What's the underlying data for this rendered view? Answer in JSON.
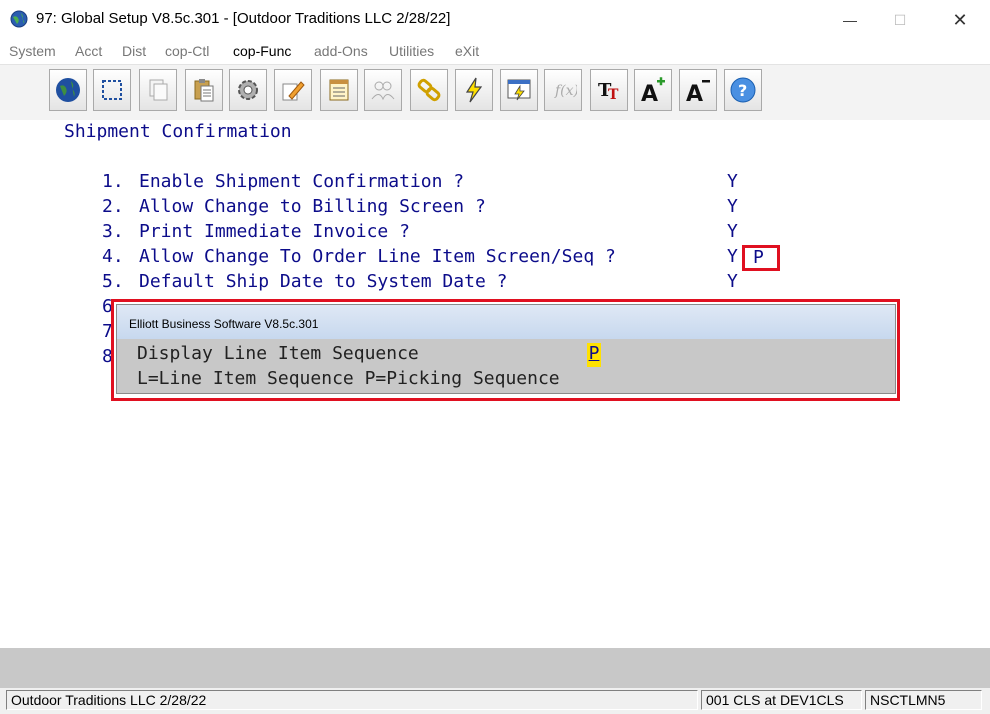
{
  "window": {
    "title": "97: Global Setup V8.5c.301 - [Outdoor Traditions LLC 2/28/22]",
    "minimize_glyph": "—",
    "maximize_glyph": "☐",
    "close_glyph": "✕"
  },
  "menu": [
    {
      "label": "System",
      "active": false
    },
    {
      "label": "Acct",
      "active": false
    },
    {
      "label": "Dist",
      "active": false
    },
    {
      "label": "cop-Ctl",
      "active": false
    },
    {
      "label": "cop-Func",
      "active": true
    },
    {
      "label": "add-Ons",
      "active": false
    },
    {
      "label": "Utilities",
      "active": false
    },
    {
      "label": "eXit",
      "active": false
    }
  ],
  "toolbar": [
    {
      "icon": "globe-icon",
      "enabled": true
    },
    {
      "icon": "select-icon",
      "enabled": true
    },
    {
      "icon": "copy-icon",
      "enabled": false
    },
    {
      "icon": "paste-icon",
      "enabled": true
    },
    {
      "icon": "settings-icon",
      "enabled": true
    },
    {
      "icon": "edit-icon",
      "enabled": true
    },
    {
      "icon": "notes-icon",
      "enabled": true
    },
    {
      "icon": "users-icon",
      "enabled": false
    },
    {
      "icon": "link-icon",
      "enabled": true
    },
    {
      "icon": "lightning-icon",
      "enabled": true
    },
    {
      "icon": "quick-screen-icon",
      "enabled": true
    },
    {
      "icon": "function-icon",
      "enabled": false
    },
    {
      "icon": "font-icon",
      "enabled": true
    },
    {
      "icon": "font-increase-icon",
      "enabled": true
    },
    {
      "icon": "font-decrease-icon",
      "enabled": true
    },
    {
      "icon": "help-icon",
      "enabled": true
    }
  ],
  "screen": {
    "heading": "Shipment Confirmation",
    "items": [
      {
        "num": "1.",
        "label": "Enable Shipment Confirmation ?",
        "value": "Y"
      },
      {
        "num": "2.",
        "label": "Allow Change to Billing Screen ?",
        "value": "Y"
      },
      {
        "num": "3.",
        "label": "Print Immediate Invoice ?",
        "value": "Y"
      },
      {
        "num": "4.",
        "label": "Allow Change To Order Line Item Screen/Seq ?",
        "value": "Y"
      },
      {
        "num": "5.",
        "label": "Default Ship Date to System Date ?",
        "value": "Y"
      }
    ],
    "hidden_item_numbers": [
      "6",
      "7",
      "8"
    ],
    "seq_value": "P"
  },
  "popup": {
    "title": "Elliott Business Software V8.5c.301",
    "line1": "Display Line Item Sequence",
    "value": "P",
    "line2": "L=Line Item Sequence P=Picking Sequence"
  },
  "status": {
    "company": "Outdoor Traditions LLC 2/28/22",
    "location": "001 CLS at DEV1CLS",
    "program": "NSCTLMN5"
  },
  "colors": {
    "text_blue": "#0c0c8a",
    "highlight_red": "#e01020",
    "field_yellow": "#ffe100"
  }
}
